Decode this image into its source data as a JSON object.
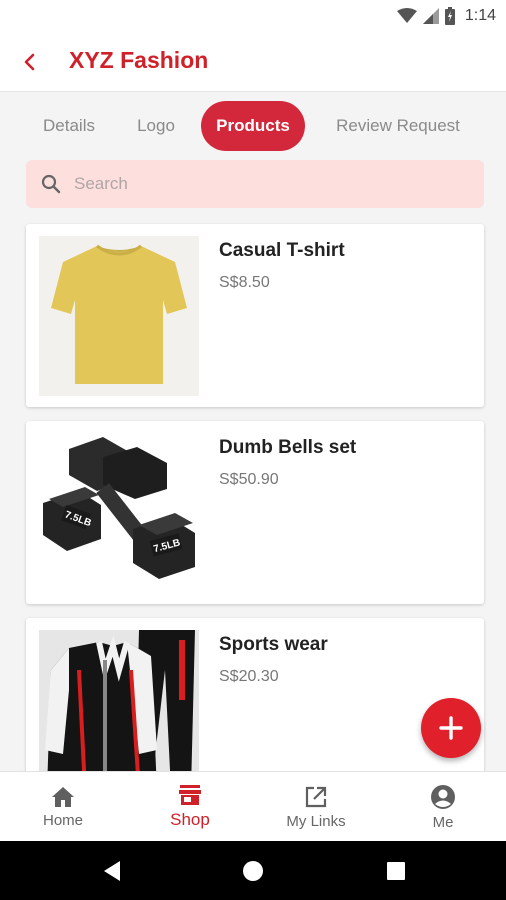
{
  "status_bar": {
    "time": "1:14"
  },
  "header": {
    "title": "XYZ Fashion"
  },
  "tabs": [
    {
      "label": "Details",
      "active": false
    },
    {
      "label": "Logo",
      "active": false
    },
    {
      "label": "Products",
      "active": true
    },
    {
      "label": "Review Request",
      "active": false
    }
  ],
  "search": {
    "placeholder": "Search",
    "value": ""
  },
  "products": [
    {
      "name": "Casual T-shirt",
      "price": "S$8.50",
      "image": "yellow-tshirt"
    },
    {
      "name": "Dumb Bells set",
      "price": "S$50.90",
      "image": "dumbbells",
      "weight_marking": "7.5LB"
    },
    {
      "name": "Sports wear",
      "price": "S$20.30",
      "image": "tracksuit"
    }
  ],
  "bottom_nav": [
    {
      "label": "Home",
      "icon": "home-icon",
      "active": false
    },
    {
      "label": "Shop",
      "icon": "store-icon",
      "active": true
    },
    {
      "label": "My Links",
      "icon": "external-link-icon",
      "active": false
    },
    {
      "label": "Me",
      "icon": "account-circle-icon",
      "active": false
    }
  ],
  "colors": {
    "brand": "#d0202a",
    "tab_active": "#d3283c",
    "search_bg": "#fde0de",
    "fab": "#e0202a"
  }
}
